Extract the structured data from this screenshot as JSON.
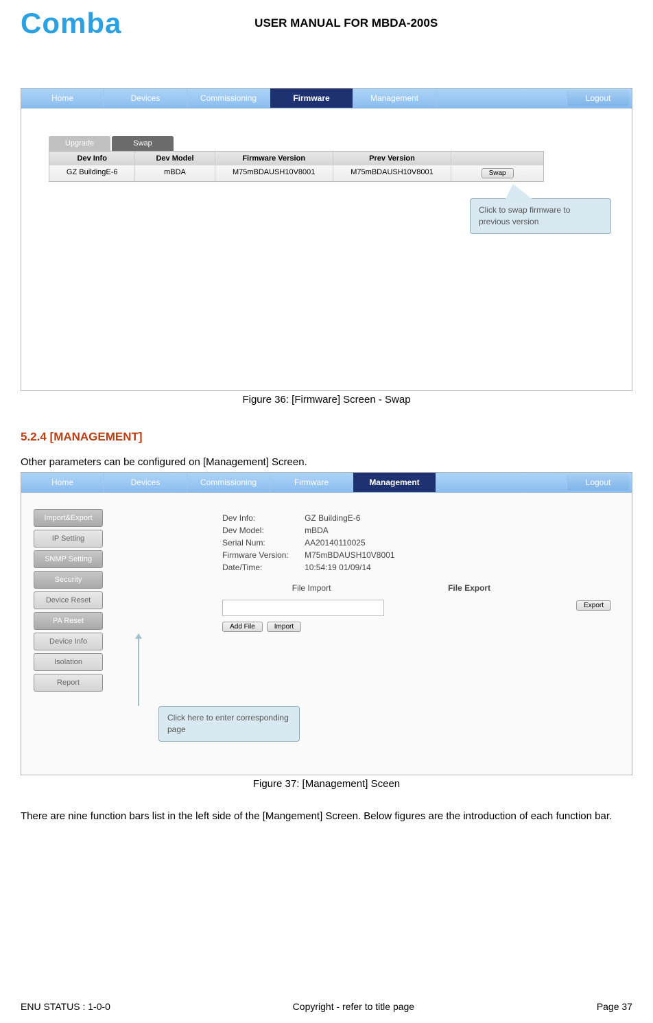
{
  "header": {
    "logo": "Comba",
    "doc_title": "USER MANUAL FOR MBDA-200S"
  },
  "shot1": {
    "nav": [
      "Home",
      "Devices",
      "Commissioning",
      "Firmware",
      "Management"
    ],
    "active_nav_index": 3,
    "logout": "Logout",
    "subtabs": {
      "inactive": "Upgrade",
      "active": "Swap"
    },
    "table": {
      "headers": [
        "Dev Info",
        "Dev Model",
        "Firmware Version",
        "Prev Version"
      ],
      "row": {
        "dev_info": "GZ BuildingE-6",
        "dev_model": "mBDA",
        "fw_version": "M75mBDAUSH10V8001",
        "prev_version": "M75mBDAUSH10V8001",
        "action": "Swap"
      }
    },
    "tooltip": "Click to swap firmware to previous version"
  },
  "caption1": "Figure 36: [Firmware] Screen - Swap",
  "section": {
    "number_title": "5.2.4    [MANAGEMENT]",
    "intro": "Other parameters can be configured on [Management] Screen."
  },
  "shot2": {
    "nav": [
      "Home",
      "Devices",
      "Commissioning",
      "Firmware",
      "Management"
    ],
    "active_nav_index": 4,
    "logout": "Logout",
    "sidebar": [
      "Import&Export",
      "IP Setting",
      "SNMP Setting",
      "Security",
      "Device Reset",
      "PA Reset",
      "Device Info",
      "Isolation",
      "Report"
    ],
    "info": {
      "dev_info_label": "Dev Info:",
      "dev_info": "GZ BuildingE-6",
      "dev_model_label": "Dev Model:",
      "dev_model": "mBDA",
      "serial_label": "Serial Num:",
      "serial": "AA20140110025",
      "fw_label": "Firmware Version:",
      "fw": "M75mBDAUSH10V8001",
      "dt_label": "Date/Time:",
      "dt": "10:54:19 01/09/14"
    },
    "cols": {
      "import": "File Import",
      "export": "File Export"
    },
    "buttons": {
      "add": "Add File",
      "import": "Import",
      "export": "Export"
    },
    "tooltip": "Click here to enter corresponding page"
  },
  "caption2": "Figure 37: [Management] Sceen",
  "closing": "There are nine function bars list in the left side of the [Mangement] Screen. Below figures are the introduction of each function bar.",
  "footer": {
    "left": "ENU STATUS : 1-0-0",
    "center": "Copyright - refer to title page",
    "right": "Page 37"
  }
}
